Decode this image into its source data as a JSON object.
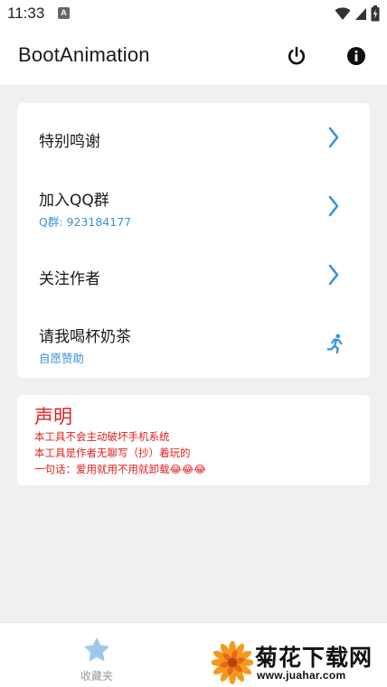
{
  "status_bar": {
    "time": "11:33",
    "notification_icon_letter": "A",
    "icons": [
      "wifi-icon",
      "signal-icon",
      "battery-charging-icon"
    ]
  },
  "app_bar": {
    "title": "BootAnimation",
    "actions": [
      "power-icon",
      "info-icon"
    ]
  },
  "menu": {
    "items": [
      {
        "label": "特别鸣谢",
        "subtitle": "",
        "trailing_icon": "chevron-right-icon"
      },
      {
        "label": "加入QQ群",
        "subtitle": "Q群: 923184177",
        "trailing_icon": "chevron-right-icon"
      },
      {
        "label": "关注作者",
        "subtitle": "",
        "trailing_icon": "chevron-right-icon"
      },
      {
        "label": "请我喝杯奶茶",
        "subtitle": "自愿赞助",
        "trailing_icon": "running-person-icon"
      }
    ]
  },
  "notice": {
    "title": "声明",
    "lines": [
      "本工具不会主动破坏手机系统",
      "本工具是作者无聊写（抄）着玩的",
      "一句话：爱用就用不用就卸载😂😂😂"
    ]
  },
  "bottom_nav": {
    "favorites_label": "收藏夹",
    "favorites_icon": "star-icon"
  },
  "watermark": {
    "title": "菊花下载网",
    "url": "www.juahar.com"
  },
  "colors": {
    "accent_blue": "#3a92d8",
    "notice_red": "#e02020",
    "background": "#f0f0f0",
    "card": "#ffffff"
  }
}
